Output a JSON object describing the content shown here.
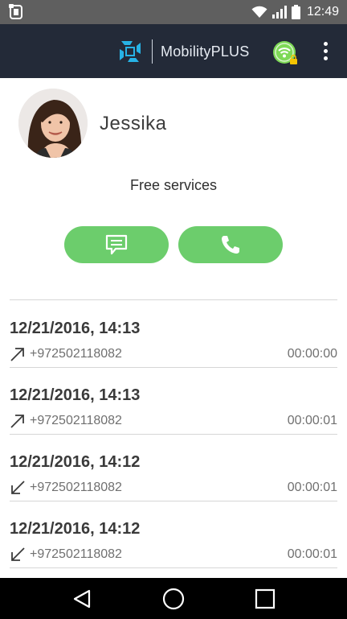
{
  "status_bar": {
    "time": "12:49",
    "icons": [
      "app-notification-icon",
      "wifi-icon",
      "signal-icon",
      "battery-icon"
    ]
  },
  "header": {
    "brand_name": "MobilityPLUS",
    "icons": [
      "mobilityplus-logo-icon",
      "wifi-locked-status-icon",
      "overflow-menu-icon"
    ],
    "colors": {
      "background": "#232a38",
      "logo": "#27b3e6",
      "status_badge": "#7ed957",
      "lock": "#f5c400"
    }
  },
  "contact": {
    "name": "Jessika",
    "service": "Free services",
    "actions": [
      {
        "name": "message",
        "icon": "chat-bubble-icon"
      },
      {
        "name": "call",
        "icon": "phone-icon"
      }
    ],
    "colors": {
      "action_button": "#6ccd6c"
    }
  },
  "calls": [
    {
      "datetime": "12/21/2016, 14:13",
      "direction": "outgoing",
      "direction_icon": "outgoing-arrow-icon",
      "number": "+972502118082",
      "duration": "00:00:00"
    },
    {
      "datetime": "12/21/2016, 14:13",
      "direction": "outgoing",
      "direction_icon": "outgoing-arrow-icon",
      "number": "+972502118082",
      "duration": "00:00:01"
    },
    {
      "datetime": "12/21/2016, 14:12",
      "direction": "incoming",
      "direction_icon": "incoming-arrow-icon",
      "number": "+972502118082",
      "duration": "00:00:01"
    },
    {
      "datetime": "12/21/2016, 14:12",
      "direction": "incoming",
      "direction_icon": "incoming-arrow-icon",
      "number": "+972502118082",
      "duration": "00:00:01"
    }
  ],
  "nav_bar": {
    "buttons": [
      "back-icon",
      "home-icon",
      "recents-icon"
    ]
  }
}
